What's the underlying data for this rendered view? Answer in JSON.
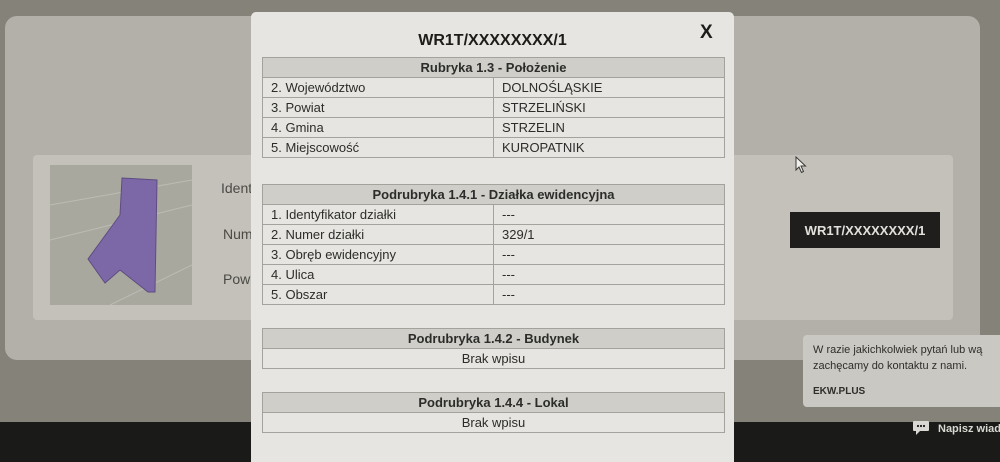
{
  "background": {
    "labels": [
      "Ident",
      "Num",
      "Powi"
    ],
    "badge": "WR1T/XXXXXXXX/1",
    "chat": {
      "line1": "W razie jakichkolwiek pytań lub wą",
      "line2": "zachęcamy do kontaktu z nami.",
      "brand": "EKW.PLUS",
      "launcher": "Napisz wiad"
    }
  },
  "modal": {
    "title": "WR1T/XXXXXXXX/1",
    "close": "X",
    "sections": [
      {
        "header": "Rubryka 1.3 - Położenie",
        "rows": [
          [
            "2. Województwo",
            "DOLNOŚLĄSKIE"
          ],
          [
            "3. Powiat",
            "STRZELIŃSKI"
          ],
          [
            "4. Gmina",
            "STRZELIN"
          ],
          [
            "5. Miejscowość",
            "KUROPATNIK"
          ]
        ]
      },
      {
        "header": "Podrubryka 1.4.1 - Działka ewidencyjna",
        "rows": [
          [
            "1. Identyfikator działki",
            "---"
          ],
          [
            "2. Numer działki",
            "329/1"
          ],
          [
            "3. Obręb ewidencyjny",
            "---"
          ],
          [
            "4. Ulica",
            "---"
          ],
          [
            "5. Obszar",
            "---"
          ]
        ]
      },
      {
        "header": "Podrubryka 1.4.2 - Budynek",
        "empty": "Brak wpisu"
      },
      {
        "header": "Podrubryka 1.4.4 - Lokal",
        "empty": "Brak wpisu"
      }
    ]
  }
}
